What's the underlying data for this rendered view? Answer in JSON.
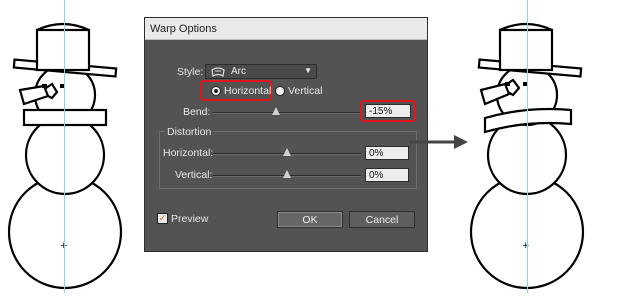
{
  "dialog": {
    "title": "Warp Options",
    "style_label": "Style:",
    "style_value": "Arc",
    "orientation": {
      "horizontal_label": "Horizontal",
      "vertical_label": "Vertical",
      "selected": "Horizontal"
    },
    "bend": {
      "label": "Bend:",
      "value": "-15%",
      "level": -0.15
    },
    "distortion": {
      "group_label": "Distortion",
      "horizontal_label": "Horizontal:",
      "horizontal_value": "0%",
      "horizontal_level": 0,
      "vertical_label": "Vertical:",
      "vertical_value": "0%",
      "vertical_level": 0
    },
    "preview": {
      "label": "Preview",
      "checked": true,
      "check_glyph": "✓"
    },
    "ok_label": "OK",
    "cancel_label": "Cancel"
  },
  "colors": {
    "highlight": "#e3141c",
    "dialog_bg": "#535353",
    "guide": "#8fd3e6"
  },
  "icons": {
    "style_icon": "arc-warp-icon",
    "dropdown": "chevron-down-icon",
    "result_arrow": "right-arrow-icon"
  }
}
